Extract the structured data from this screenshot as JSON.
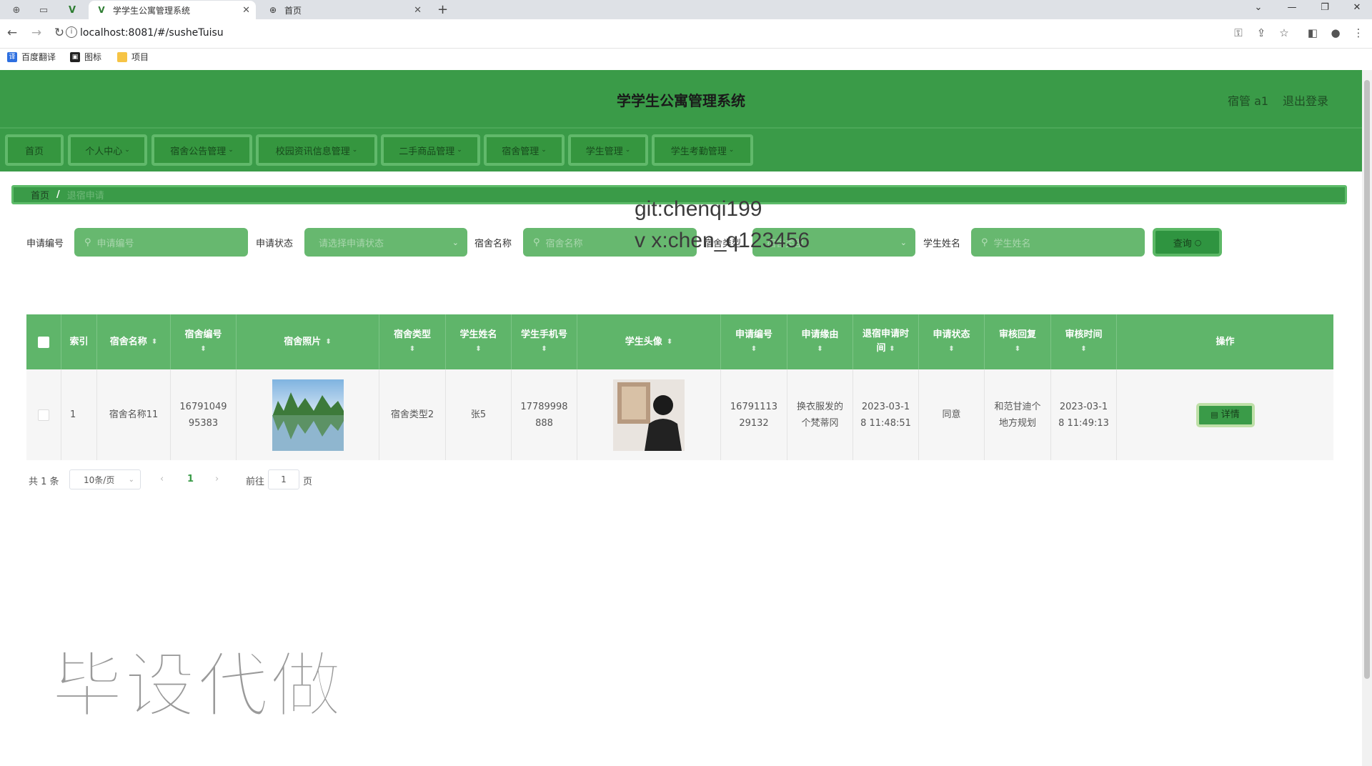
{
  "browser": {
    "tabs": [
      {
        "title": "学学生公寓管理系统",
        "icon": "vue-logo-icon",
        "active": true
      },
      {
        "title": "首页",
        "icon": "globe-icon",
        "active": false
      }
    ],
    "url": "localhost:8081/#/susheTuisu",
    "bookmarks": [
      "百度翻译",
      "图标",
      "项目"
    ]
  },
  "header": {
    "title": "学学生公寓管理系统",
    "user": "宿管 a1",
    "logout": "退出登录"
  },
  "nav": {
    "items": [
      "首页",
      "个人中心",
      "宿舍公告管理",
      "校园资讯信息管理",
      "二手商品管理",
      "宿舍管理",
      "学生管理",
      "学生考勤管理"
    ]
  },
  "breadcrumb": {
    "home": "首页",
    "separator": "/",
    "current": "退宿申请"
  },
  "search": {
    "apply_no_label": "申请编号",
    "apply_no_placeholder": "申请编号",
    "status_label": "申请状态",
    "status_placeholder": "请选择申请状态",
    "dorm_name_label": "宿舍名称",
    "dorm_name_placeholder": "宿舍名称",
    "dorm_type_label": "宿舍类型",
    "dorm_type_placeholder": "宿舍类型",
    "student_name_label": "学生姓名",
    "student_name_placeholder": "学生姓名",
    "query_button": "查询"
  },
  "watermark": {
    "git": "git:chenqi199",
    "vx": "v x:chen_q123456",
    "bottom": "毕设代做"
  },
  "table": {
    "headers": {
      "index": "索引",
      "dorm_name": "宿舍名称",
      "dorm_no": "宿舍编号",
      "dorm_photo": "宿舍照片",
      "dorm_type": "宿舍类型",
      "student_name": "学生姓名",
      "student_phone": "学生手机号",
      "student_avatar": "学生头像",
      "apply_no": "申请编号",
      "reason": "申请缘由",
      "apply_time_1": "退宿申请时",
      "apply_time_2": "间",
      "status": "申请状态",
      "reply": "审核回复",
      "review_time": "审核时间",
      "action": "操作"
    },
    "rows": [
      {
        "index": "1",
        "dorm_name": "宿舍名称11",
        "dorm_no_1": "16791049",
        "dorm_no_2": "95383",
        "dorm_type": "宿舍类型2",
        "student_name": "张5",
        "student_phone_1": "17789998",
        "student_phone_2": "888",
        "apply_no_1": "16791113",
        "apply_no_2": "29132",
        "reason_1": "换衣服发的",
        "reason_2": "个梵蒂冈",
        "apply_time_1": "2023-03-1",
        "apply_time_2": "8 11:48:51",
        "status": "同意",
        "reply_1": "和范甘迪个",
        "reply_2": "地方规划",
        "review_time_1": "2023-03-1",
        "review_time_2": "8 11:49:13",
        "detail_button": "详情"
      }
    ]
  },
  "pagination": {
    "total": "共 1 条",
    "page_size": "10条/页",
    "current_page": "1",
    "goto_prefix": "前往",
    "goto_value": "1",
    "goto_suffix": "页"
  },
  "colors": {
    "primary": "#3a9b48",
    "table_header": "#5fb56a",
    "input_bg": "#67b86f"
  }
}
